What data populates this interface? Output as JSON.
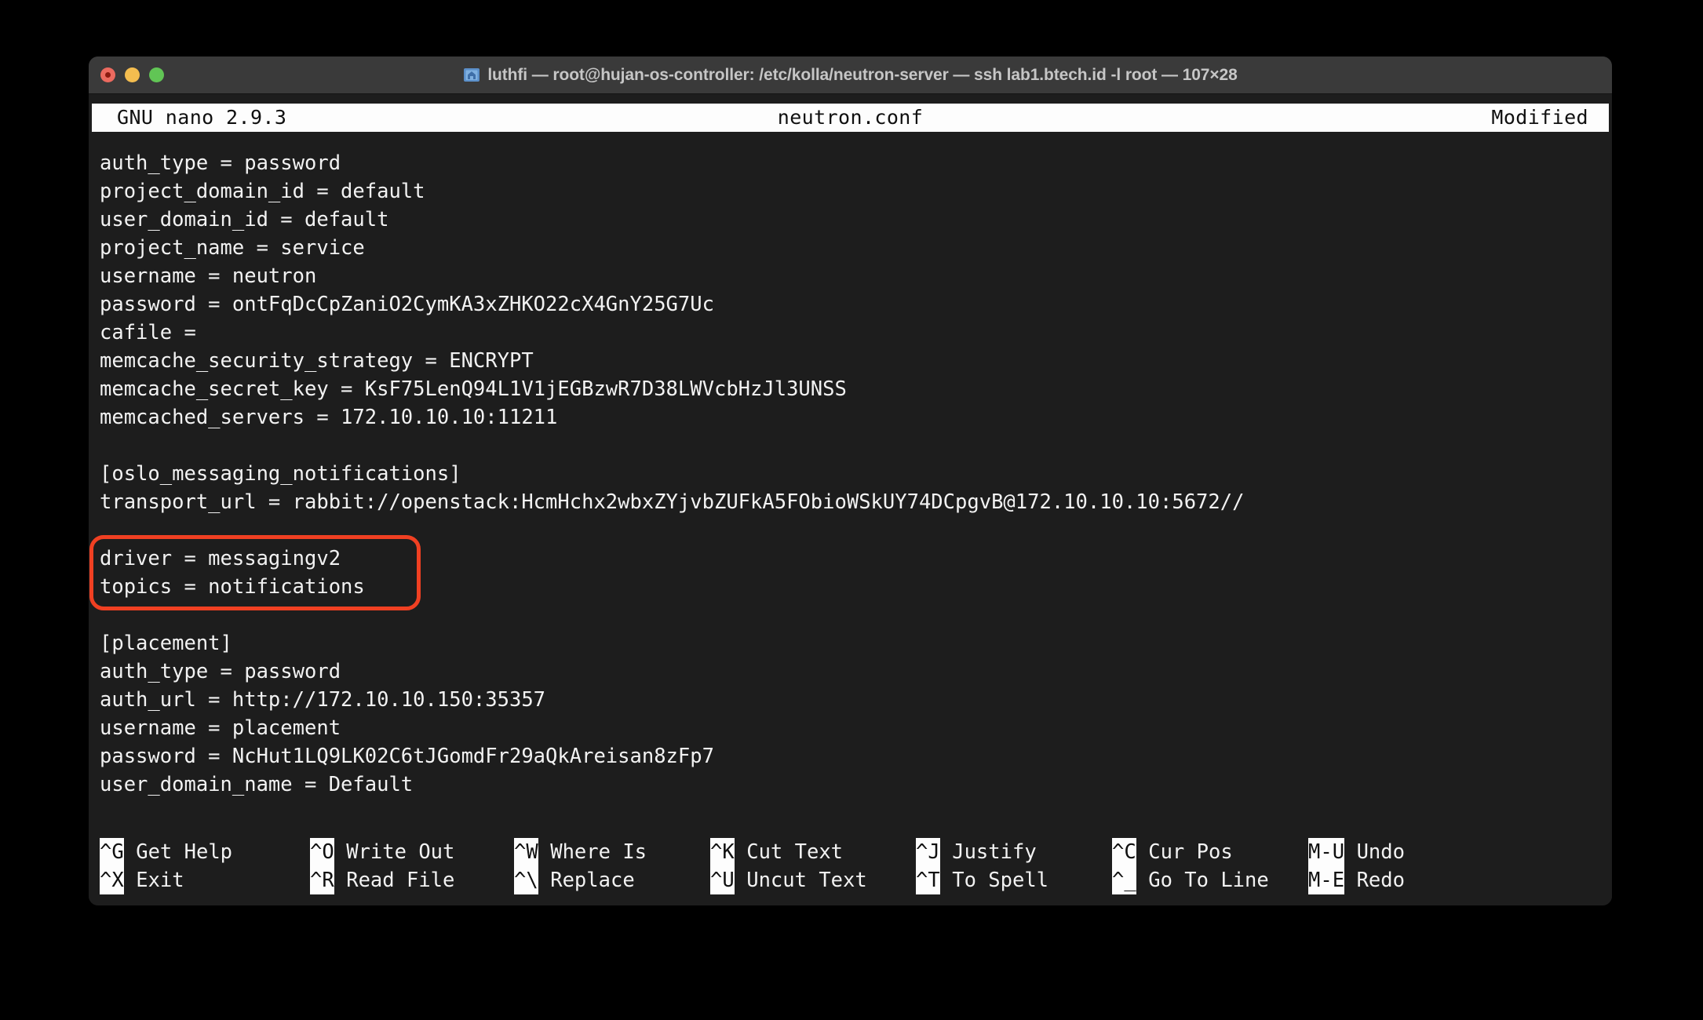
{
  "window": {
    "title": "luthfi — root@hujan-os-controller: /etc/kolla/neutron-server — ssh lab1.btech.id -l root — 107×28",
    "icon": "folder-icon",
    "traffic_lights": {
      "close_label": "Close",
      "minimize_label": "Minimize",
      "maximize_label": "Maximize",
      "close_color": "#ec6a5f",
      "minimize_color": "#f4bd4f",
      "maximize_color": "#61c555"
    },
    "titlebar_color": "#3a3a3a",
    "background_color": "#1d1d1d"
  },
  "editor": {
    "version": "GNU nano 2.9.3",
    "filename": "neutron.conf",
    "status": "Modified",
    "cursor": {
      "line_index": 16,
      "column": 0,
      "char": "["
    },
    "lines": [
      "auth_type = password",
      "project_domain_id = default",
      "user_domain_id = default",
      "project_name = service",
      "username = neutron",
      "password = ontFqDcCpZaniO2CymKA3xZHKO22cX4GnY25G7Uc",
      "cafile =",
      "memcache_security_strategy = ENCRYPT",
      "memcache_secret_key = KsF75LenQ94L1V1jEGBzwR7D38LWVcbHzJl3UNSS",
      "memcached_servers = 172.10.10.10:11211",
      "",
      "[oslo_messaging_notifications]",
      "transport_url = rabbit://openstack:HcmHchx2wbxZYjvbZUFkA5FObioWSkUY74DCpgvB@172.10.10.10:5672//",
      "",
      "driver = messagingv2",
      "topics = notifications",
      "",
      "[placement]",
      "auth_type = password",
      "auth_url = http://172.10.10.150:35357",
      "username = placement",
      "password = NcHut1LQ9LK02C6tJGomdFr29aQkAreisan8zFp7",
      "user_domain_name = Default"
    ]
  },
  "annotation": {
    "shape": "rounded-rectangle",
    "color": "#f04022",
    "targets": [
      "driver = messagingv2",
      "topics = notifications"
    ]
  },
  "shortcuts": [
    {
      "key": "^G",
      "label": "Get Help",
      "key2": "^X",
      "label2": "Exit"
    },
    {
      "key": "^O",
      "label": "Write Out",
      "key2": "^R",
      "label2": "Read File"
    },
    {
      "key": "^W",
      "label": "Where Is",
      "key2": "^\\",
      "label2": "Replace"
    },
    {
      "key": "^K",
      "label": "Cut Text",
      "key2": "^U",
      "label2": "Uncut Text"
    },
    {
      "key": "^J",
      "label": "Justify",
      "key2": "^T",
      "label2": "To Spell"
    },
    {
      "key": "^C",
      "label": "Cur Pos",
      "key2": "^_",
      "label2": "Go To Line"
    },
    {
      "key": "M-U",
      "label": "Undo",
      "key2": "M-E",
      "label2": "Redo"
    }
  ]
}
